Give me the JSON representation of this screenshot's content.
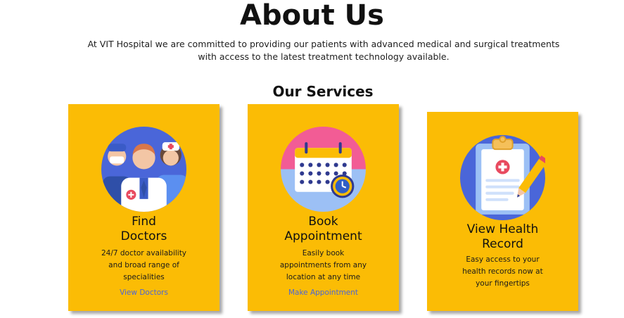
{
  "page": {
    "title": "About Us",
    "intro": "At VIT Hospital we are committed to providing our patients with advanced medical and surgical treatments with access to the latest treatment technology available.",
    "services_heading": "Our Services"
  },
  "services": [
    {
      "title_line1": "Find",
      "title_line2": "Doctors",
      "description": "24/7 doctor availability and broad range of specialities",
      "link": "View Doctors",
      "icon": "doctors-icon"
    },
    {
      "title_line1": "Book",
      "title_line2": "Appointment",
      "description": "Easily book appointments from any location at any time",
      "link": "Make Appointment",
      "icon": "calendar-icon"
    },
    {
      "title_line1": "View Health",
      "title_line2": "Record",
      "description": "Easy access to your health records now at your fingertips",
      "link": "",
      "icon": "clipboard-icon"
    }
  ],
  "colors": {
    "card_background": "#fbbc05",
    "link": "#4a66d9",
    "icon_circle": "#4a66d9"
  }
}
